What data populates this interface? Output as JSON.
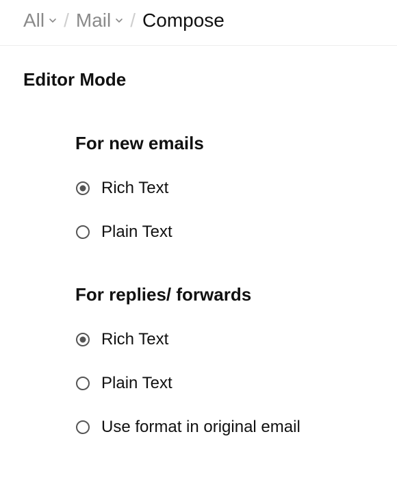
{
  "breadcrumb": {
    "items": [
      {
        "label": "All",
        "hasDropdown": true,
        "current": false
      },
      {
        "label": "Mail",
        "hasDropdown": true,
        "current": false
      },
      {
        "label": "Compose",
        "hasDropdown": false,
        "current": true
      }
    ]
  },
  "section": {
    "title": "Editor Mode",
    "groups": [
      {
        "title": "For new emails",
        "options": [
          {
            "label": "Rich Text",
            "selected": true
          },
          {
            "label": "Plain Text",
            "selected": false
          }
        ]
      },
      {
        "title": "For replies/ forwards",
        "options": [
          {
            "label": "Rich Text",
            "selected": true
          },
          {
            "label": "Plain Text",
            "selected": false
          },
          {
            "label": "Use format in original email",
            "selected": false
          }
        ]
      }
    ]
  }
}
